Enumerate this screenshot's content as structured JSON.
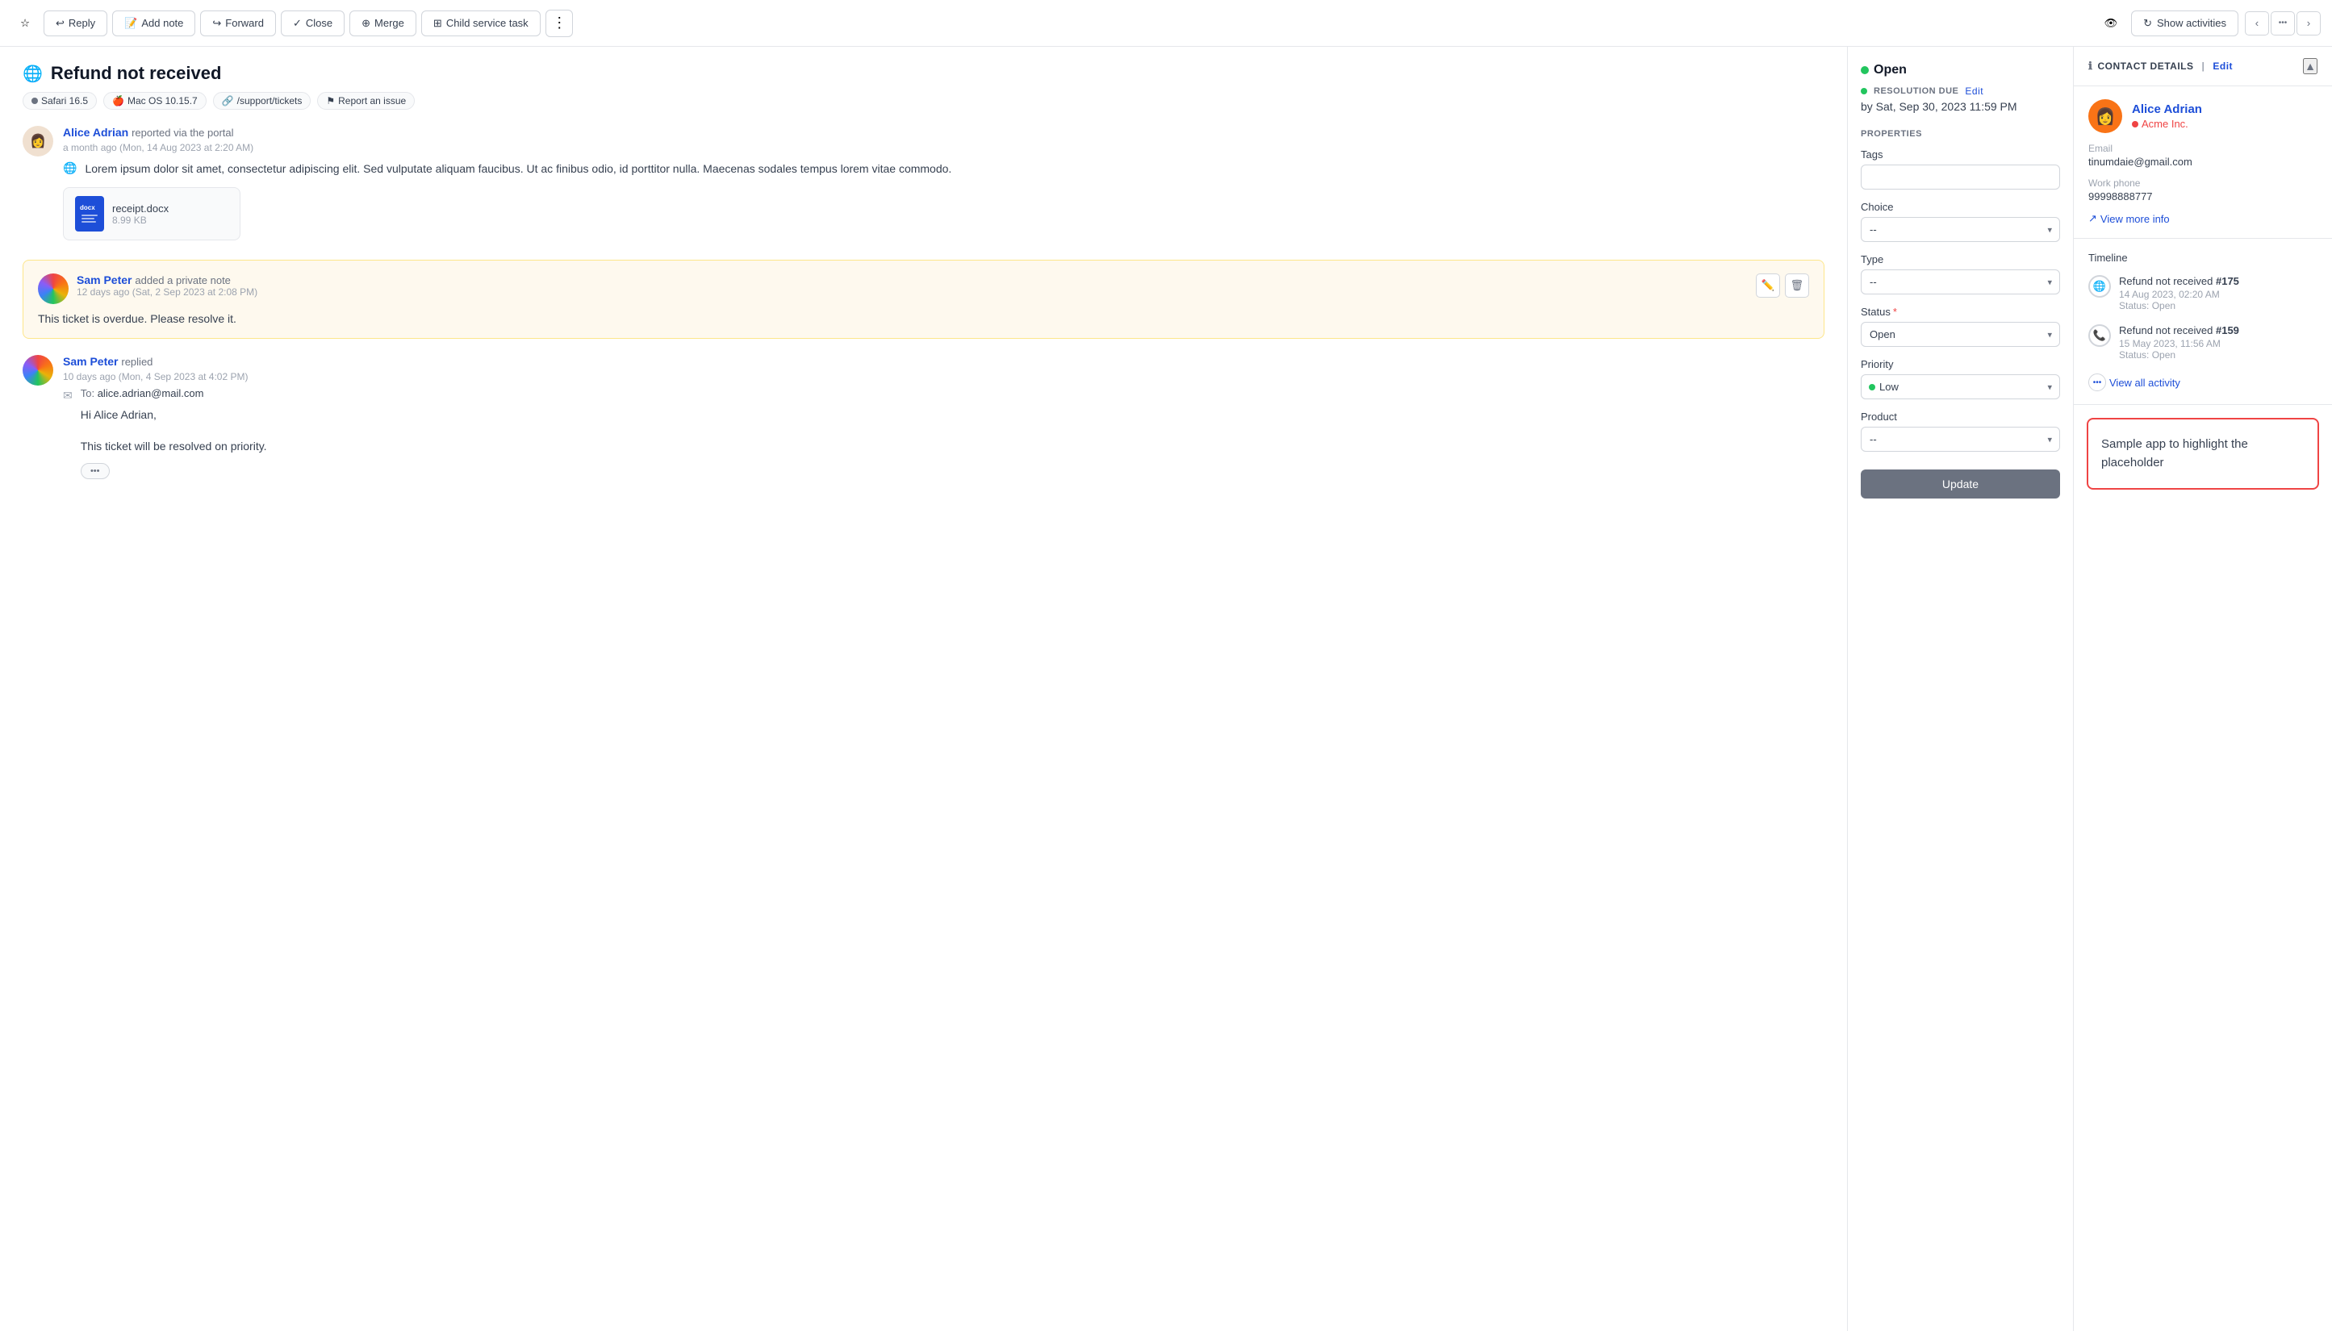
{
  "toolbar": {
    "star_label": "★",
    "reply_label": "Reply",
    "add_note_label": "Add note",
    "forward_label": "Forward",
    "close_label": "Close",
    "merge_label": "Merge",
    "child_service_task_label": "Child service task",
    "more_label": "⋯",
    "eye_label": "👁",
    "show_activities_label": "Show activities",
    "prev_label": "‹",
    "dots_label": "•••",
    "next_label": "›"
  },
  "page": {
    "title": "Refund not received",
    "meta_browser": "Safari 16.5",
    "meta_os": "Mac OS 10.15.7",
    "meta_url": "/support/tickets",
    "meta_report": "Report an issue"
  },
  "conversation": {
    "author": "Alice Adrian",
    "action": "reported via the portal",
    "time": "a month ago (Mon, 14 Aug 2023 at 2:20 AM)",
    "body": "Lorem ipsum dolor sit amet, consectetur adipiscing elit. Sed vulputate aliquam faucibus. Ut ac finibus odio, id porttitor nulla. Maecenas sodales tempus lorem vitae commodo.",
    "attachment_name": "receipt.docx",
    "attachment_size": "8.99 KB"
  },
  "private_note": {
    "author": "Sam Peter",
    "action": "added a private note",
    "time": "12 days ago (Sat, 2 Sep 2023 at 2:08 PM)",
    "text": "This ticket is overdue. Please resolve it."
  },
  "reply": {
    "author": "Sam Peter",
    "action": "replied",
    "time": "10 days ago (Mon, 4 Sep 2023 at 4:02 PM)",
    "to": "alice.adrian@mail.com",
    "greeting": "Hi Alice Adrian,",
    "body": "This ticket will be resolved on priority.",
    "more_label": "•••"
  },
  "middle_panel": {
    "status": "Open",
    "resolution_label": "RESOLUTION DUE",
    "resolution_edit": "Edit",
    "resolution_date": "by Sat, Sep 30, 2023 11:59 PM",
    "properties_label": "PROPERTIES",
    "tags_label": "Tags",
    "choice_label": "Choice",
    "choice_placeholder": "--",
    "type_label": "Type",
    "type_placeholder": "--",
    "status_label": "Status",
    "status_value": "Open",
    "priority_label": "Priority",
    "priority_value": "Low",
    "product_label": "Product",
    "product_placeholder": "--",
    "update_label": "Update"
  },
  "right_panel": {
    "contact_details_title": "CONTACT DETAILS",
    "edit_label": "Edit",
    "contact_name": "Alice Adrian",
    "company": "Acme Inc.",
    "email_label": "Email",
    "email_value": "tinumdaie@gmail.com",
    "work_phone_label": "Work phone",
    "work_phone_value": "99998888777",
    "view_more_label": "View more info",
    "timeline_title": "Timeline",
    "timeline_items": [
      {
        "title": "Refund not received",
        "number": "#175",
        "date": "14 Aug 2023, 02:20 AM",
        "status": "Status: Open",
        "icon": "🌐"
      },
      {
        "title": "Refund not received",
        "number": "#159",
        "date": "15 May 2023, 11:56 AM",
        "status": "Status: Open",
        "icon": "📞"
      }
    ],
    "view_all_label": "View all activity",
    "placeholder_text": "Sample app to highlight the placeholder"
  }
}
